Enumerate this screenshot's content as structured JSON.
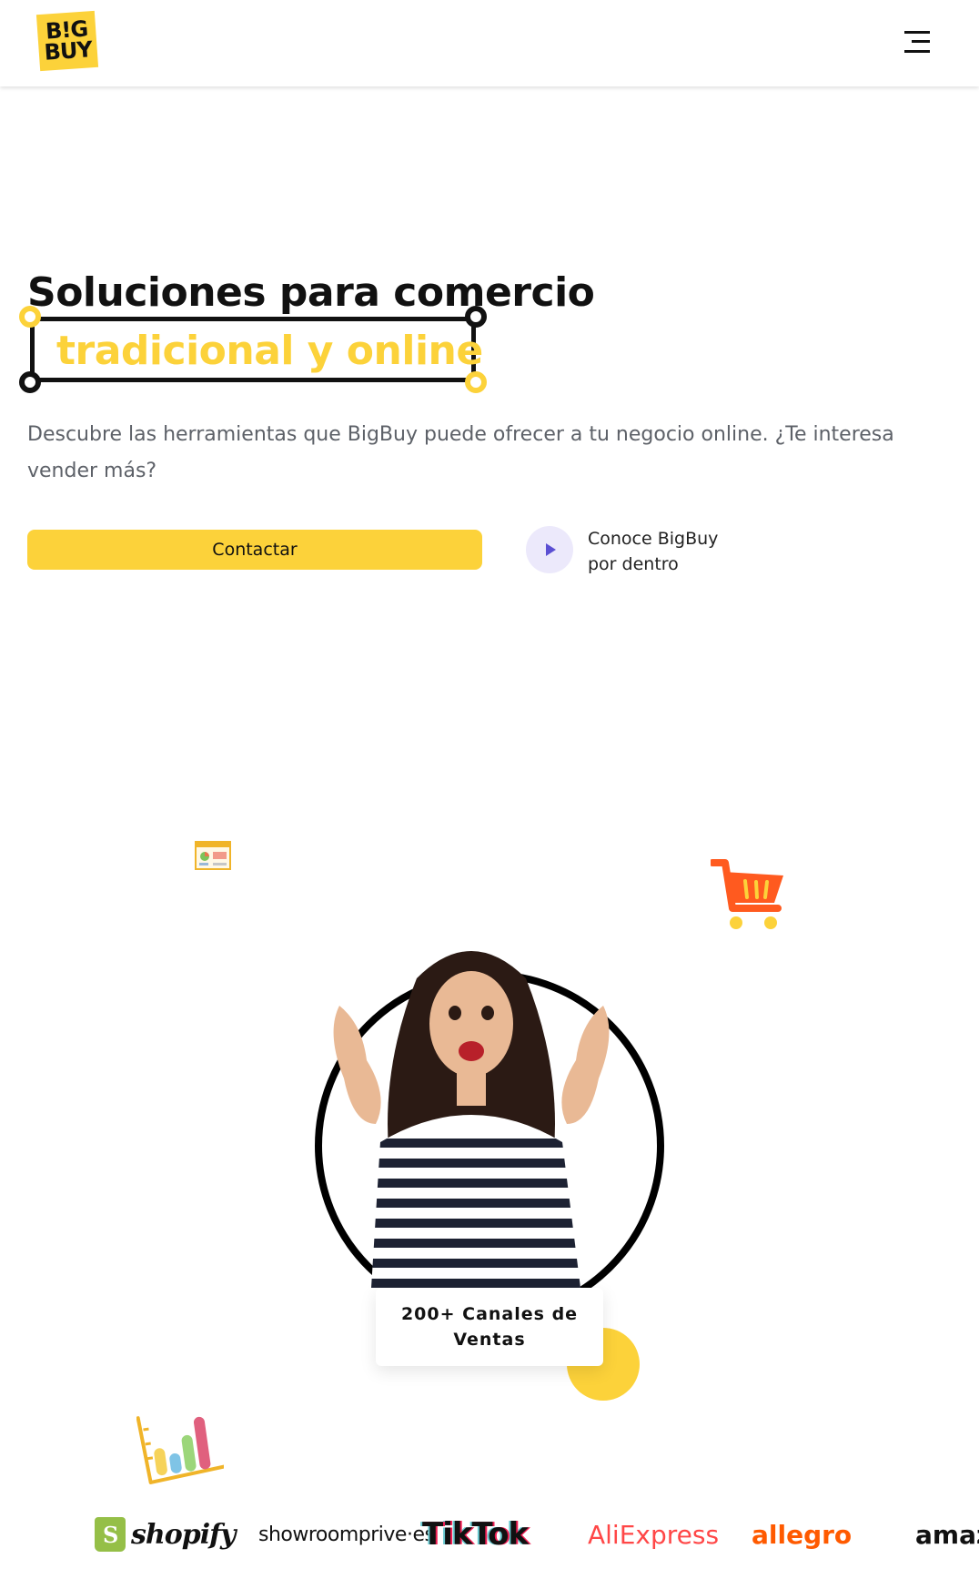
{
  "header": {
    "logo_line1": "B!G",
    "logo_line2": "BUY"
  },
  "hero": {
    "title_line1": "Soluciones para comercio",
    "title_line2": "tradicional y online",
    "description": "Descubre las herramientas que BigBuy puede ofrecer a tu negocio online. ¿Te interesa vender más?",
    "contact_button": "Contactar",
    "video_line1": "Conoce BigBuy",
    "video_line2": "por dentro"
  },
  "badge": {
    "text": "200+ Canales de Ventas"
  },
  "brands": {
    "shopify": "shopify",
    "showroomprive": "showroomprive·es",
    "tiktok": "TikTok",
    "aliexpress": "AliExpress",
    "allegro": "allegro",
    "amazon": "amazo"
  },
  "colors": {
    "accent": "#fcd23a",
    "text": "#111111",
    "muted": "#5d6168",
    "play_bg": "#ece9fb",
    "cart": "#ff5a1f"
  },
  "icons": {
    "menu": "hamburger-menu-icon",
    "play": "play-icon",
    "window": "browser-window-icon",
    "cart": "shopping-cart-icon",
    "bars": "bar-chart-icon"
  }
}
